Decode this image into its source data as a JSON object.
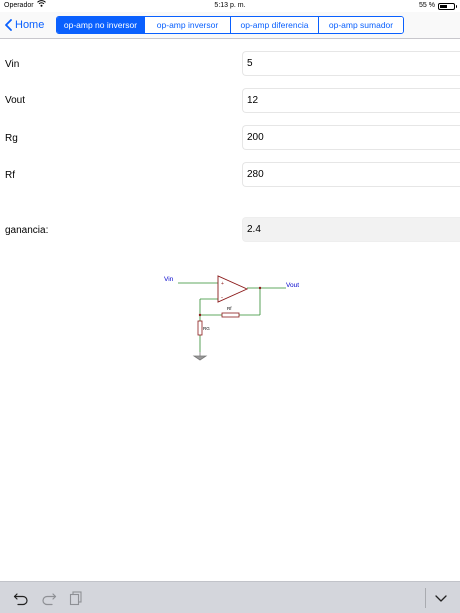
{
  "status_bar": {
    "carrier": "Operador",
    "time": "5:13 p. m.",
    "battery_percent": "55 %",
    "battery_level": 0.55
  },
  "nav": {
    "back_label": "Home",
    "segments": [
      "op-amp no inversor",
      "op-amp inversor",
      "op-amp diferencia",
      "op-amp sumador"
    ],
    "selected_segment": 0
  },
  "form": {
    "vin": {
      "label": "Vin",
      "value": "5"
    },
    "vout": {
      "label": "Vout",
      "value": "12"
    },
    "rg": {
      "label": "Rg",
      "value": "200"
    },
    "rf": {
      "label": "Rf",
      "value": "280"
    },
    "ganancia": {
      "label": "ganancia:",
      "value": "2.4"
    }
  },
  "circuit": {
    "vin_label": "Vin",
    "vout_label": "Vout",
    "rf_label": "Rf",
    "rg_label": "RG",
    "plus_sign": "+",
    "minus_sign": "-"
  },
  "colors": {
    "accent": "#0a60fe",
    "opamp": "#8b1a1a",
    "wire": "#2e8b2e",
    "circuit_label": "#0000cc"
  },
  "toolbar": {
    "icons": [
      "undo-icon",
      "redo-icon",
      "paste-icon",
      "chevron-down-icon"
    ]
  }
}
